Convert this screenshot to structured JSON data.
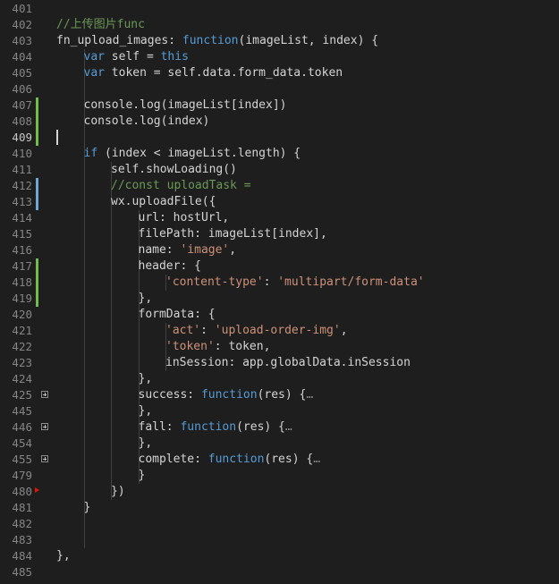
{
  "editor": {
    "colors": {
      "background": "#1e1e1e",
      "keyword": "#569cd6",
      "string": "#ce9178",
      "comment": "#6a9955",
      "text": "#d4d4d4",
      "line_number": "#858585",
      "added_marker": "#6fbf4a",
      "modified_marker": "#6fa8d6",
      "breakpoint_arrow": "#e51400"
    },
    "lines": [
      {
        "num": "401",
        "tokens": []
      },
      {
        "num": "402",
        "indent": 1,
        "tokens": [
          {
            "t": "//上传图片func",
            "c": "cmt"
          }
        ]
      },
      {
        "num": "403",
        "indent": 1,
        "tokens": [
          {
            "t": "fn_upload_images: ",
            "c": "plain"
          },
          {
            "t": "function",
            "c": "kw"
          },
          {
            "t": "(imageList, index) {",
            "c": "plain"
          }
        ]
      },
      {
        "num": "404",
        "indent": 2,
        "tokens": [
          {
            "t": "var",
            "c": "kw"
          },
          {
            "t": " self = ",
            "c": "plain"
          },
          {
            "t": "this",
            "c": "kw"
          }
        ]
      },
      {
        "num": "405",
        "indent": 2,
        "tokens": [
          {
            "t": "var",
            "c": "kw"
          },
          {
            "t": " token = self.data.form_data.token",
            "c": "plain"
          }
        ]
      },
      {
        "num": "406",
        "tokens": []
      },
      {
        "num": "407",
        "indent": 2,
        "marker": "added",
        "tokens": [
          {
            "t": "console.log(imageList[index])",
            "c": "plain"
          }
        ]
      },
      {
        "num": "408",
        "indent": 2,
        "marker": "added",
        "tokens": [
          {
            "t": "console.log(index)",
            "c": "plain"
          }
        ]
      },
      {
        "num": "409",
        "marker": "added",
        "active": true,
        "cursor": true,
        "tokens": []
      },
      {
        "num": "410",
        "indent": 2,
        "tokens": [
          {
            "t": "if",
            "c": "kw"
          },
          {
            "t": " (index < imageList.length) {",
            "c": "plain"
          }
        ]
      },
      {
        "num": "411",
        "indent": 3,
        "tokens": [
          {
            "t": "self.showLoading()",
            "c": "plain"
          }
        ]
      },
      {
        "num": "412",
        "indent": 3,
        "marker": "modified",
        "tokens": [
          {
            "t": "//const uploadTask =",
            "c": "cmt"
          }
        ]
      },
      {
        "num": "413",
        "indent": 3,
        "marker": "modified",
        "tokens": [
          {
            "t": "wx.uploadFile({",
            "c": "plain"
          }
        ]
      },
      {
        "num": "414",
        "indent": 4,
        "tokens": [
          {
            "t": "url: hostUrl,",
            "c": "plain"
          }
        ]
      },
      {
        "num": "415",
        "indent": 4,
        "tokens": [
          {
            "t": "filePath: imageList[index],",
            "c": "plain"
          }
        ]
      },
      {
        "num": "416",
        "indent": 4,
        "tokens": [
          {
            "t": "name: ",
            "c": "plain"
          },
          {
            "t": "'image'",
            "c": "str"
          },
          {
            "t": ",",
            "c": "plain"
          }
        ]
      },
      {
        "num": "417",
        "indent": 4,
        "marker": "added",
        "tokens": [
          {
            "t": "header: {",
            "c": "plain"
          }
        ]
      },
      {
        "num": "418",
        "indent": 5,
        "marker": "added",
        "tokens": [
          {
            "t": "'content-type'",
            "c": "str"
          },
          {
            "t": ": ",
            "c": "plain"
          },
          {
            "t": "'multipart/form-data'",
            "c": "str"
          }
        ]
      },
      {
        "num": "419",
        "indent": 4,
        "marker": "added",
        "tokens": [
          {
            "t": "},",
            "c": "plain"
          }
        ]
      },
      {
        "num": "420",
        "indent": 4,
        "tokens": [
          {
            "t": "formData: {",
            "c": "plain"
          }
        ]
      },
      {
        "num": "421",
        "indent": 5,
        "tokens": [
          {
            "t": "'act'",
            "c": "str"
          },
          {
            "t": ": ",
            "c": "plain"
          },
          {
            "t": "'upload-order-img'",
            "c": "str"
          },
          {
            "t": ",",
            "c": "plain"
          }
        ]
      },
      {
        "num": "422",
        "indent": 5,
        "tokens": [
          {
            "t": "'token'",
            "c": "str"
          },
          {
            "t": ": token,",
            "c": "plain"
          }
        ]
      },
      {
        "num": "423",
        "indent": 5,
        "tokens": [
          {
            "t": "inSession: app.globalData.inSession",
            "c": "plain"
          }
        ]
      },
      {
        "num": "424",
        "indent": 4,
        "tokens": [
          {
            "t": "},",
            "c": "plain"
          }
        ]
      },
      {
        "num": "425",
        "indent": 4,
        "fold": true,
        "tokens": [
          {
            "t": "success: ",
            "c": "plain"
          },
          {
            "t": "function",
            "c": "kw"
          },
          {
            "t": "(res) {",
            "c": "plain"
          },
          {
            "t": "…",
            "c": "ellipsis"
          }
        ]
      },
      {
        "num": "445",
        "indent": 4,
        "tokens": [
          {
            "t": "},",
            "c": "plain"
          }
        ]
      },
      {
        "num": "446",
        "indent": 4,
        "fold": true,
        "tokens": [
          {
            "t": "fall: ",
            "c": "plain"
          },
          {
            "t": "function",
            "c": "kw"
          },
          {
            "t": "(res) {",
            "c": "plain"
          },
          {
            "t": "…",
            "c": "ellipsis"
          }
        ]
      },
      {
        "num": "454",
        "indent": 4,
        "tokens": [
          {
            "t": "},",
            "c": "plain"
          }
        ]
      },
      {
        "num": "455",
        "indent": 4,
        "fold": true,
        "tokens": [
          {
            "t": "complete: ",
            "c": "plain"
          },
          {
            "t": "function",
            "c": "kw"
          },
          {
            "t": "(res) {",
            "c": "plain"
          },
          {
            "t": "…",
            "c": "ellipsis"
          }
        ]
      },
      {
        "num": "479",
        "indent": 4,
        "tokens": [
          {
            "t": "}",
            "c": "plain"
          }
        ]
      },
      {
        "num": "480",
        "indent": 3,
        "breakpoint": true,
        "tokens": [
          {
            "t": "})",
            "c": "plain"
          }
        ]
      },
      {
        "num": "481",
        "indent": 2,
        "tokens": [
          {
            "t": "}",
            "c": "plain"
          }
        ]
      },
      {
        "num": "482",
        "tokens": []
      },
      {
        "num": "483",
        "tokens": []
      },
      {
        "num": "484",
        "indent": 1,
        "tokens": [
          {
            "t": "},",
            "c": "plain"
          }
        ]
      },
      {
        "num": "485",
        "tokens": []
      }
    ]
  }
}
